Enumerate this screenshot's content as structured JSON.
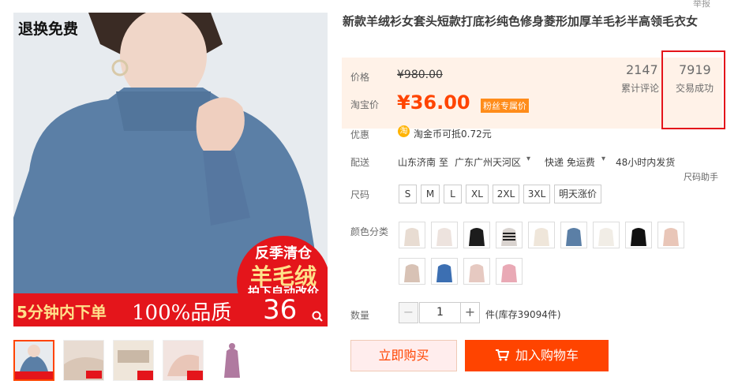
{
  "gallery": {
    "badge_top_left": "退换免费",
    "promo_circle": [
      "反季清仓",
      "羊毛绒",
      "拍下自动改价"
    ],
    "promo_bar": {
      "left": "5分钟内下单",
      "middle": "100%品质",
      "right": "36"
    },
    "thumb_count": 5
  },
  "product": {
    "title": "新款羊绒衫女套头短款打底衫纯色修身菱形加厚羊毛衫半高领毛衣女"
  },
  "price": {
    "price_label": "价格",
    "original_price": "¥980.00",
    "taobao_label": "淘宝价",
    "current_price": "¥36.00",
    "fan_tag": "粉丝专属价",
    "reviews_count": "2147",
    "reviews_label": "累计评论",
    "deals_count": "7919",
    "deals_label": "交易成功"
  },
  "offer": {
    "label": "优惠",
    "coin_icon_text": "淘",
    "text": "淘金币可抵",
    "amount": "0.72元"
  },
  "delivery": {
    "label": "配送",
    "from": "山东济南",
    "to_word": "至",
    "to": "广东广州天河区",
    "method": "快递 免运费",
    "ship_time": "48小时内发货",
    "size_helper": "尺码助手",
    "report": "举报"
  },
  "size": {
    "label": "尺码",
    "options": [
      "S",
      "M",
      "L",
      "XL",
      "2XL",
      "3XL",
      "明天涨价"
    ]
  },
  "color": {
    "label": "颜色分类",
    "swatch_colors": [
      "#e8dcd2",
      "#ede3de",
      "#1c1c1c",
      "#d9d3cf",
      "#efe6da",
      "#5b7fa6",
      "#f1ede6",
      "#111111",
      "#e9c6b8",
      "#d8c2b5",
      "#3c6fb2",
      "#e6c9c1",
      "#e9a9b5"
    ]
  },
  "quantity": {
    "label": "数量",
    "minus": "−",
    "value": "1",
    "plus": "+",
    "unit": "件",
    "stock": "(库存39094件)"
  },
  "actions": {
    "buy_now": "立即购买",
    "add_cart": "加入购物车",
    "cart_icon": "cart-icon"
  },
  "colors": {
    "accent": "#ff4400",
    "promo_red": "#e4151b",
    "price_bg": "#fff2e8"
  }
}
